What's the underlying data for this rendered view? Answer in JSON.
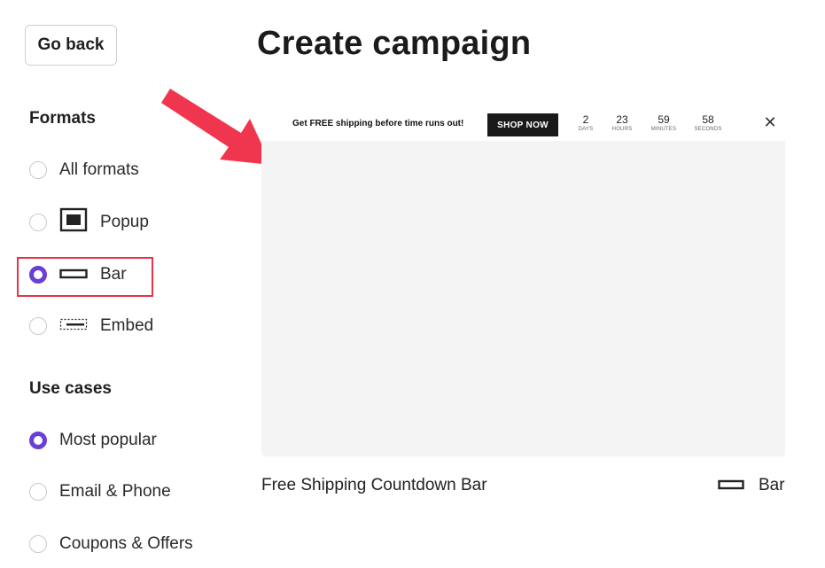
{
  "header": {
    "go_back_label": "Go back",
    "page_title": "Create campaign"
  },
  "sidebar": {
    "formats_title": "Formats",
    "formats": [
      {
        "label": "All formats",
        "icon": "none",
        "selected": false
      },
      {
        "label": "Popup",
        "icon": "popup-icon",
        "selected": false
      },
      {
        "label": "Bar",
        "icon": "bar-icon",
        "selected": true
      },
      {
        "label": "Embed",
        "icon": "embed-icon",
        "selected": false
      }
    ],
    "use_cases_title": "Use cases",
    "use_cases": [
      {
        "label": "Most popular",
        "selected": true
      },
      {
        "label": "Email & Phone",
        "selected": false
      },
      {
        "label": "Coupons & Offers",
        "selected": false
      }
    ]
  },
  "preview": {
    "bar_message": "Get FREE shipping before time runs out!",
    "shop_button": "SHOP NOW",
    "countdown": [
      {
        "value": "2",
        "unit": "DAYS"
      },
      {
        "value": "23",
        "unit": "HOURS"
      },
      {
        "value": "59",
        "unit": "MINUTES"
      },
      {
        "value": "58",
        "unit": "SECONDS"
      }
    ],
    "close_glyph": "✕"
  },
  "card": {
    "title": "Free Shipping Countdown Bar",
    "type_label": "Bar",
    "type_icon": "bar-icon"
  },
  "colors": {
    "accent_purple": "#6a3fd6",
    "annotation_red": "#e8334a",
    "preview_bg": "#f4f4f4"
  }
}
